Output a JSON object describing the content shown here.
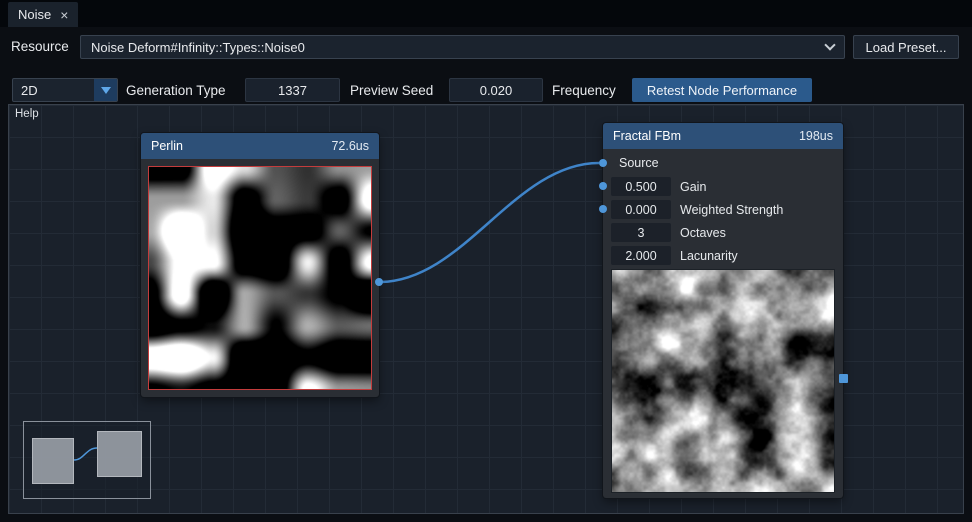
{
  "icons": {
    "close": "×"
  },
  "tab_bar": {
    "tab": "Noise"
  },
  "resource_bar": {
    "label": "Resource",
    "value": "Noise Deform#Infinity::Types::Noise0",
    "load_preset": "Load Preset..."
  },
  "toolbar": {
    "dimension": "2D",
    "generation_type_label": "Generation Type",
    "seed_value": "1337",
    "preview_seed_label": "Preview Seed",
    "frequency_value": "0.020",
    "frequency_label": "Frequency",
    "retest_label": "Retest Node Performance"
  },
  "graph": {
    "help_label": "Help",
    "perlin": {
      "title": "Perlin",
      "time": "72.6us"
    },
    "fbm": {
      "title": "Fractal FBm",
      "time": "198us",
      "source_label": "Source",
      "rows": [
        {
          "value": "0.500",
          "label": "Gain"
        },
        {
          "value": "0.000",
          "label": "Weighted Strength"
        },
        {
          "value": "3",
          "label": "Octaves"
        },
        {
          "value": "2.000",
          "label": "Lacunarity"
        }
      ]
    }
  },
  "colors": {
    "accent_blue": "#4e96d9",
    "node_header": "#2d5078",
    "selection_red": "#c43c3c",
    "link": "#3f84c9",
    "retest_button": "#2b5a8c"
  }
}
